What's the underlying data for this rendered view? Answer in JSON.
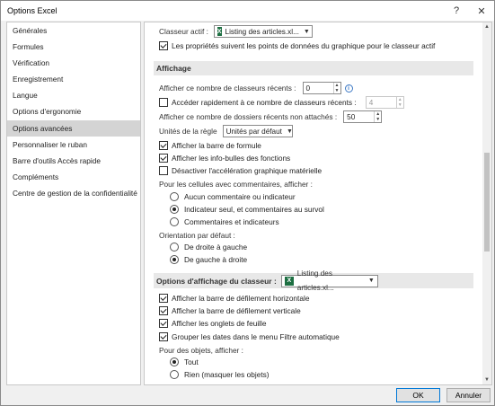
{
  "window": {
    "title": "Options Excel",
    "help_glyph": "?",
    "close_glyph": "✕"
  },
  "sidebar": {
    "items": [
      {
        "label": "Générales",
        "selected": false
      },
      {
        "label": "Formules",
        "selected": false
      },
      {
        "label": "Vérification",
        "selected": false
      },
      {
        "label": "Enregistrement",
        "selected": false
      },
      {
        "label": "Langue",
        "selected": false
      },
      {
        "label": "Options d'ergonomie",
        "selected": false
      },
      {
        "label": "Options avancées",
        "selected": true
      },
      {
        "label": "Personnaliser le ruban",
        "selected": false
      },
      {
        "label": "Barre d'outils Accès rapide",
        "selected": false
      },
      {
        "label": "Compléments",
        "selected": false
      },
      {
        "label": "Centre de gestion de la confidentialité",
        "selected": false
      }
    ]
  },
  "chart_options": {
    "workbook_label": "Classeur actif :",
    "workbook_value": "Listing des articles.xl...",
    "properties_follow_label": "Les propriétés suivent les points de données du graphique pour le classeur actif",
    "properties_follow_checked": true
  },
  "display": {
    "header": "Affichage",
    "recent_workbooks_label": "Afficher ce nombre de classeurs récents :",
    "recent_workbooks_value": "0",
    "quick_access_label": "Accéder rapidement à ce nombre de classeurs récents :",
    "quick_access_checked": false,
    "quick_access_value": "4",
    "recent_folders_label": "Afficher ce nombre de dossiers récents non attachés :",
    "recent_folders_value": "50",
    "ruler_units_label": "Unités de la règle",
    "ruler_units_value": "Unités par défaut",
    "formula_bar_label": "Afficher la barre de formule",
    "formula_bar_checked": true,
    "function_tooltips_label": "Afficher les info-bulles des fonctions",
    "function_tooltips_checked": true,
    "disable_hw_accel_label": "Désactiver l'accélération graphique matérielle",
    "disable_hw_accel_checked": false,
    "comments_label": "Pour les cellules avec commentaires, afficher :",
    "comments_options": [
      {
        "label": "Aucun commentaire ou indicateur",
        "checked": false
      },
      {
        "label": "Indicateur seul, et commentaires au survol",
        "checked": true
      },
      {
        "label": "Commentaires et indicateurs",
        "checked": false
      }
    ],
    "direction_label": "Orientation par défaut :",
    "direction_options": [
      {
        "label": "De droite à gauche",
        "checked": false
      },
      {
        "label": "De gauche à droite",
        "checked": true
      }
    ]
  },
  "workbook_display": {
    "header": "Options d'affichage du classeur :",
    "workbook_value": "Listing des articles.xl...",
    "hscroll_label": "Afficher la barre de défilement horizontale",
    "hscroll_checked": true,
    "vscroll_label": "Afficher la barre de défilement verticale",
    "vscroll_checked": true,
    "sheet_tabs_label": "Afficher les onglets de feuille",
    "sheet_tabs_checked": true,
    "group_dates_label": "Grouper les dates dans le menu Filtre automatique",
    "group_dates_checked": true,
    "objects_label": "Pour des objets, afficher :",
    "objects_options": [
      {
        "label": "Tout",
        "checked": true
      },
      {
        "label": "Rien (masquer les objets)",
        "checked": false
      }
    ]
  },
  "footer": {
    "ok_label": "OK",
    "cancel_label": "Annuler"
  },
  "colors": {
    "accent": "#0078d7",
    "excel_green": "#1d6f42",
    "selected_bg": "#d4d4d4",
    "section_bg": "#e8e8e8"
  }
}
